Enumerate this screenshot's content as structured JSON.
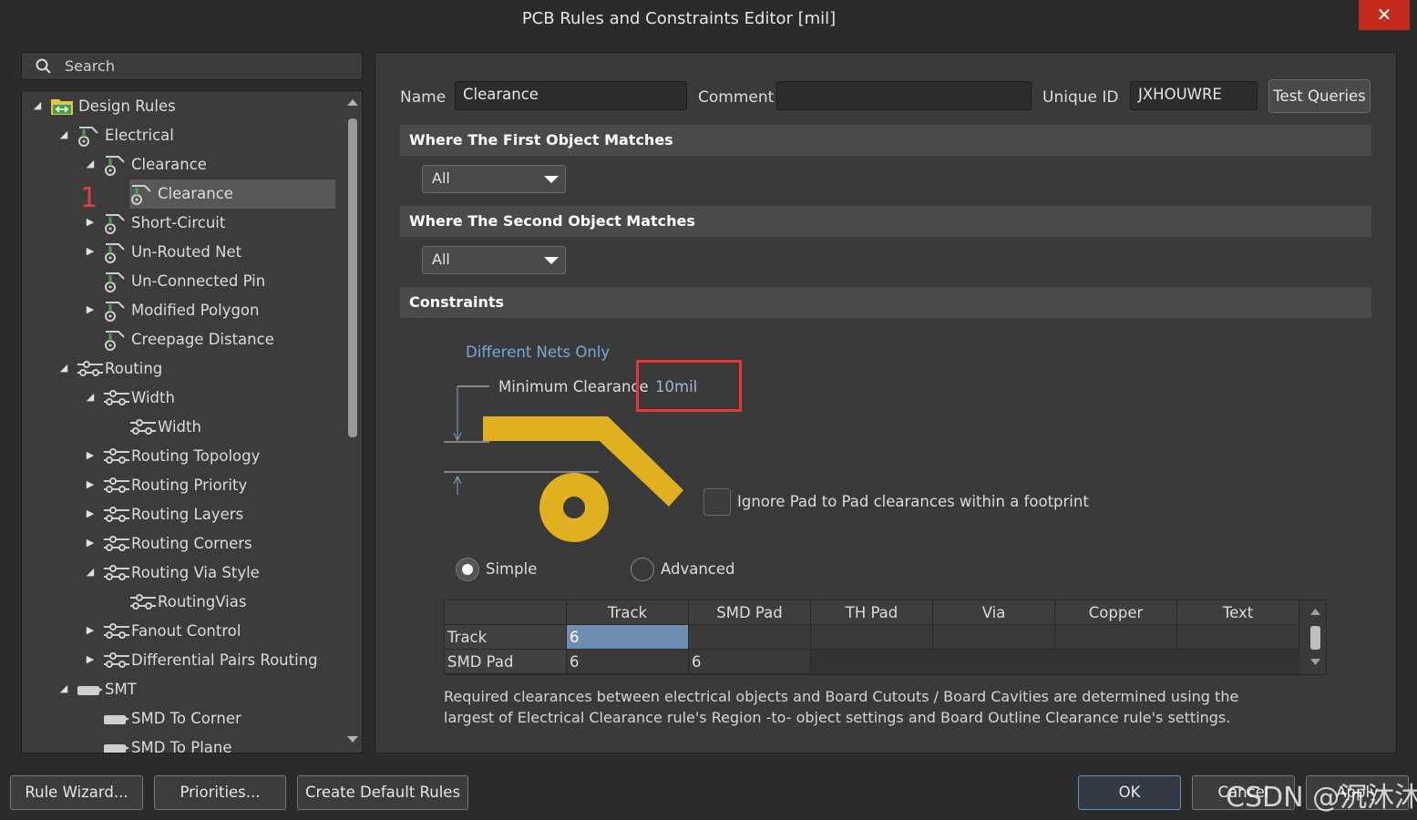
{
  "window": {
    "title": "PCB Rules and Constraints Editor [mil]",
    "close_glyph": "✕"
  },
  "search": {
    "placeholder": "Search"
  },
  "tree": {
    "annotation_number": "1",
    "items": [
      {
        "label": "Design Rules",
        "icon": "design-rules-folder-icon",
        "expander": "expanded"
      },
      {
        "label": "Electrical",
        "icon": "electrical-rule-icon",
        "expander": "expanded"
      },
      {
        "label": "Clearance",
        "icon": "electrical-rule-icon",
        "expander": "expanded"
      },
      {
        "label": "Clearance",
        "icon": "electrical-rule-icon",
        "expander": "none",
        "selected": true
      },
      {
        "label": "Short-Circuit",
        "icon": "electrical-rule-icon",
        "expander": "collapsed"
      },
      {
        "label": "Un-Routed Net",
        "icon": "electrical-rule-icon",
        "expander": "collapsed"
      },
      {
        "label": "Un-Connected Pin",
        "icon": "electrical-rule-icon",
        "expander": "none"
      },
      {
        "label": "Modified Polygon",
        "icon": "electrical-rule-icon",
        "expander": "collapsed"
      },
      {
        "label": "Creepage Distance",
        "icon": "electrical-rule-icon",
        "expander": "none"
      },
      {
        "label": "Routing",
        "icon": "routing-rule-icon",
        "expander": "expanded"
      },
      {
        "label": "Width",
        "icon": "routing-rule-icon",
        "expander": "expanded"
      },
      {
        "label": "Width",
        "icon": "routing-rule-icon",
        "expander": "none"
      },
      {
        "label": "Routing Topology",
        "icon": "routing-rule-icon",
        "expander": "collapsed"
      },
      {
        "label": "Routing Priority",
        "icon": "routing-rule-icon",
        "expander": "collapsed"
      },
      {
        "label": "Routing Layers",
        "icon": "routing-rule-icon",
        "expander": "collapsed"
      },
      {
        "label": "Routing Corners",
        "icon": "routing-rule-icon",
        "expander": "collapsed"
      },
      {
        "label": "Routing Via Style",
        "icon": "routing-rule-icon",
        "expander": "expanded"
      },
      {
        "label": "RoutingVias",
        "icon": "routing-rule-icon",
        "expander": "none"
      },
      {
        "label": "Fanout Control",
        "icon": "routing-rule-icon",
        "expander": "collapsed"
      },
      {
        "label": "Differential Pairs Routing",
        "icon": "routing-rule-icon",
        "expander": "collapsed"
      },
      {
        "label": "SMT",
        "icon": "smt-rule-icon",
        "expander": "expanded"
      },
      {
        "label": "SMD To Corner",
        "icon": "smt-rule-icon",
        "expander": "none"
      },
      {
        "label": "SMD To Plane",
        "icon": "smt-rule-icon",
        "expander": "none"
      }
    ]
  },
  "rule": {
    "name_label": "Name",
    "name_value": "Clearance",
    "comment_label": "Comment",
    "comment_value": "",
    "unique_id_label": "Unique ID",
    "unique_id_value": "JXHOUWRE",
    "test_queries_label": "Test Queries"
  },
  "first_object": {
    "heading": "Where The First Object Matches",
    "selected": "All"
  },
  "second_object": {
    "heading": "Where The Second Object Matches",
    "selected": "All"
  },
  "constraints": {
    "heading": "Constraints",
    "different_nets_label": "Different Nets Only",
    "min_clearance_label": "Minimum Clearance",
    "min_clearance_value": "10mil",
    "ignore_pad_label": "Ignore Pad to Pad clearances within a footprint",
    "ignore_pad_checked": false,
    "mode_simple_label": "Simple",
    "mode_advanced_label": "Advanced",
    "mode_selected": "Simple",
    "grid_columns": [
      "",
      "Track",
      "SMD Pad",
      "TH Pad",
      "Via",
      "Copper",
      "Text"
    ],
    "grid_rows": [
      {
        "label": "Track",
        "cells": [
          "6"
        ]
      },
      {
        "label": "SMD Pad",
        "cells": [
          "6",
          "6"
        ]
      }
    ],
    "note": "Required clearances between electrical objects and Board Cutouts / Board Cavities are determined using the largest of Electrical Clearance rule's Region -to- object settings and Board Outline Clearance rule's settings."
  },
  "footer": {
    "rule_wizard": "Rule Wizard...",
    "priorities": "Priorities...",
    "create_default_rules": "Create Default Rules",
    "ok": "OK",
    "cancel": "Cancel",
    "apply": "Apply"
  },
  "watermark": "CSDN @沉沐沐",
  "colors": {
    "accent_highlight": "#e53935",
    "track_gold": "#e0b020",
    "selected_cell": "#6d8db2",
    "link_blue": "#7ea6d8"
  }
}
